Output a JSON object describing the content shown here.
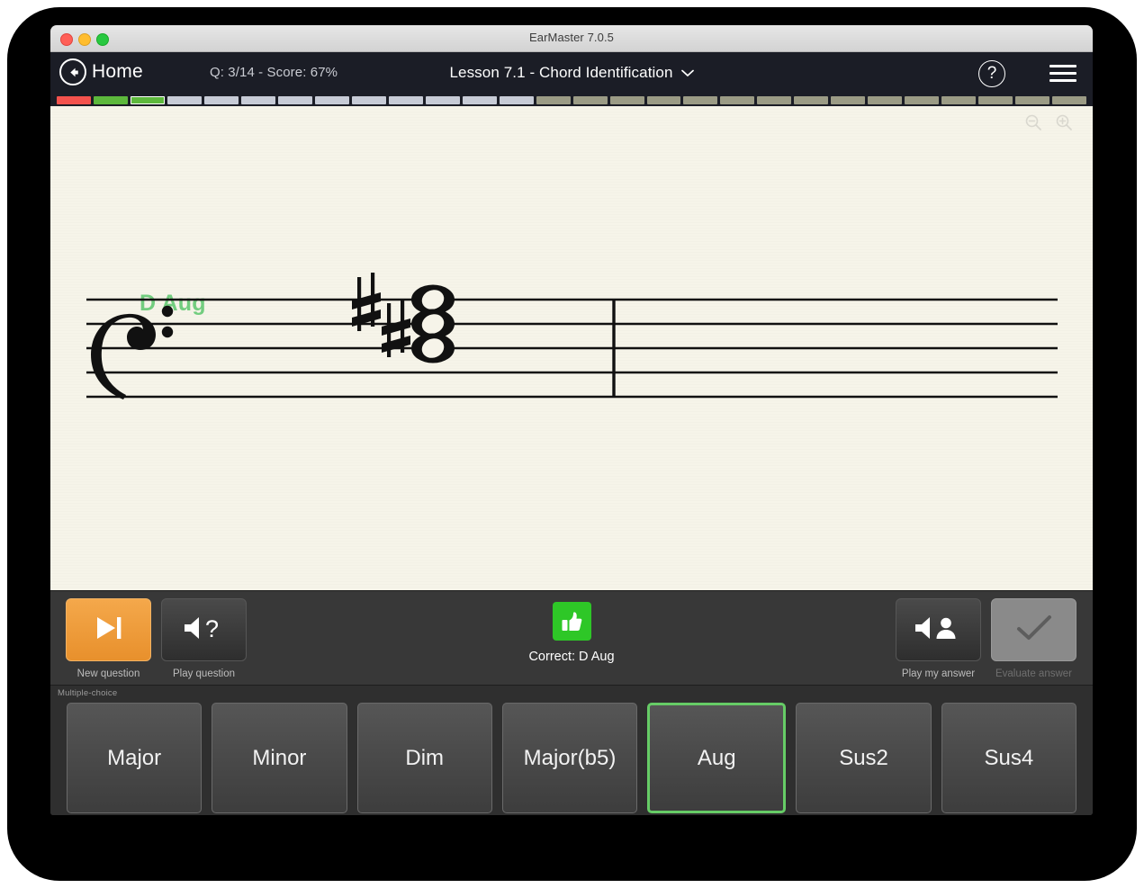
{
  "window": {
    "title": "EarMaster 7.0.5",
    "traffic_lights": [
      "close",
      "minimize",
      "maximize"
    ]
  },
  "header": {
    "home_label": "Home",
    "progress_text": "Q: 3/14 - Score: 67%",
    "lesson_title": "Lesson 7.1 - Chord Identification",
    "lesson_caret": "⌄",
    "help_glyph": "?",
    "menu_icon": "hamburger-menu-icon"
  },
  "progress_bar": {
    "total_segments": 28,
    "segments": [
      "wrong",
      "correct",
      "current",
      "pending",
      "pending",
      "pending",
      "pending",
      "pending",
      "pending",
      "pending",
      "pending",
      "pending",
      "pending",
      "future",
      "future",
      "future",
      "future",
      "future",
      "future",
      "future",
      "future",
      "future",
      "future",
      "future",
      "future",
      "future",
      "future",
      "future"
    ],
    "colors": {
      "wrong": "#f4524d",
      "correct": "#5db83c",
      "current": "#5db83c",
      "pending": "#c7cbd6",
      "future": "#9b9b85"
    }
  },
  "sheet": {
    "chord_name": "D Aug",
    "chord_name_color": "#72cd7f",
    "clef": "bass-clef",
    "zoom_out_icon": "zoom-out-icon",
    "zoom_in_icon": "zoom-in-icon",
    "background_color": "#f6f4e9",
    "notation": {
      "accidentals": [
        "sharp",
        "sharp"
      ],
      "note_heads": 3,
      "note_type": "whole-note"
    }
  },
  "controls": {
    "new_question": {
      "label": "New question",
      "icon": "skip-to-end-icon",
      "enabled": true,
      "highlight_color": "#e8902c"
    },
    "play_question": {
      "label": "Play question",
      "icon": "speaker-question-icon",
      "enabled": true
    },
    "play_my_answer": {
      "label": "Play my answer",
      "icon": "speaker-person-icon",
      "enabled": true
    },
    "evaluate_answer": {
      "label": "Evaluate answer",
      "icon": "checkmark-icon",
      "enabled": false
    },
    "feedback": {
      "icon": "thumbs-up-icon",
      "icon_color": "#2ec727",
      "text": "Correct: D Aug"
    }
  },
  "multiple_choice": {
    "label": "Multiple-choice",
    "selected_index": 4,
    "selected_border_color": "#66cc66",
    "options": [
      {
        "label": "Major"
      },
      {
        "label": "Minor"
      },
      {
        "label": "Dim"
      },
      {
        "label": "Major(b5)"
      },
      {
        "label": "Aug"
      },
      {
        "label": "Sus2"
      },
      {
        "label": "Sus4"
      }
    ]
  }
}
